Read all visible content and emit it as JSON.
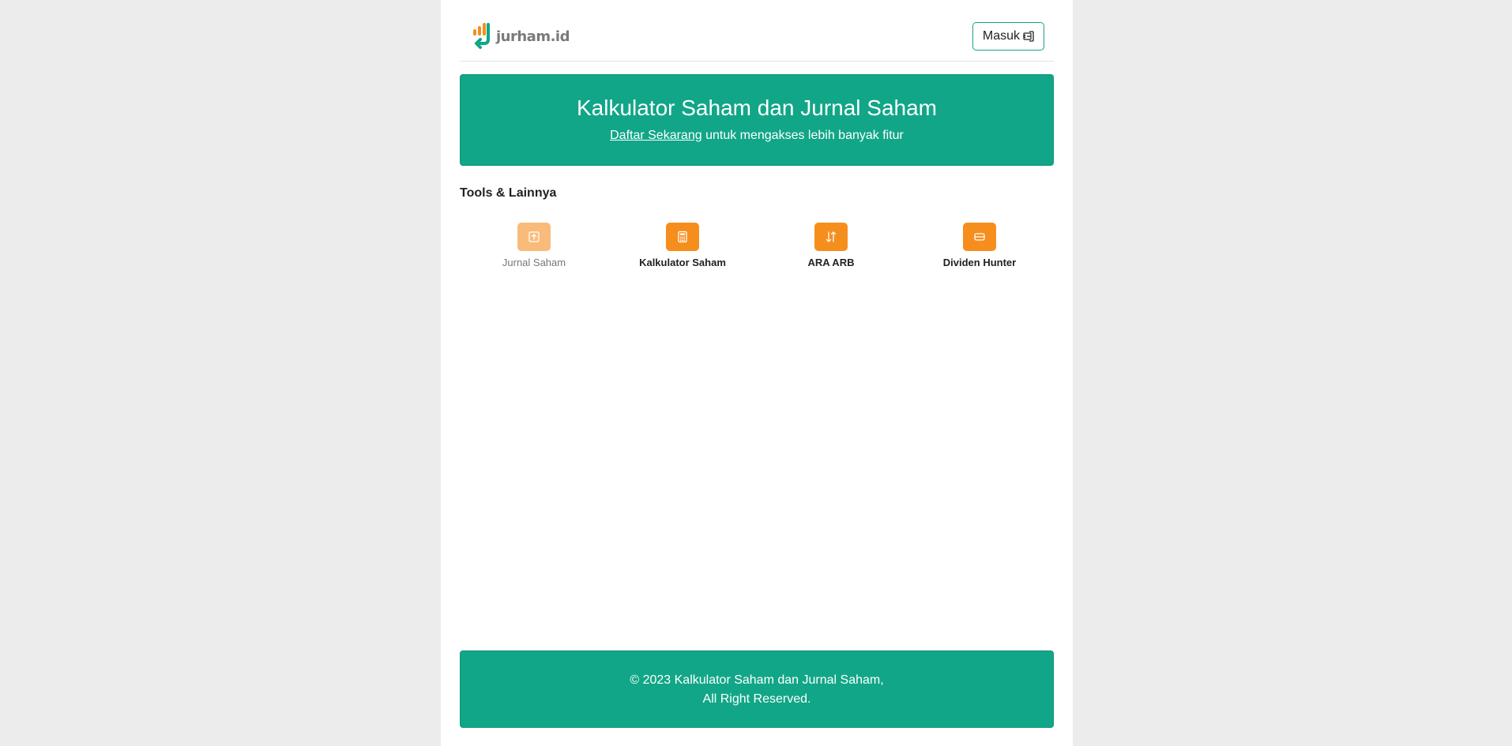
{
  "header": {
    "logo_text": "jurham.id",
    "login_label": "Masuk",
    "login_icon": "login-icon"
  },
  "hero": {
    "title": "Kalkulator Saham dan Jurnal Saham",
    "register_link": "Daftar Sekarang",
    "subtitle_rest": " untuk mengakses lebih banyak fitur"
  },
  "tools": {
    "title": "Tools & Lainnya",
    "items": [
      {
        "label": "Jurnal Saham",
        "icon": "journal-upload-icon",
        "active": false
      },
      {
        "label": "Kalkulator Saham",
        "icon": "calculator-icon",
        "active": true
      },
      {
        "label": "ARA ARB",
        "icon": "up-down-arrows-icon",
        "active": true
      },
      {
        "label": "Dividen Hunter",
        "icon": "dividend-icon",
        "active": true
      }
    ]
  },
  "footer": {
    "line1": "© 2023 Kalkulator Saham dan Jurnal Saham,",
    "line2": "All Right Reserved."
  },
  "colors": {
    "brand_green": "#11a687",
    "tool_orange": "#f68e1e",
    "tool_orange_faded": "#f9bb7a",
    "background": "#ececec"
  }
}
